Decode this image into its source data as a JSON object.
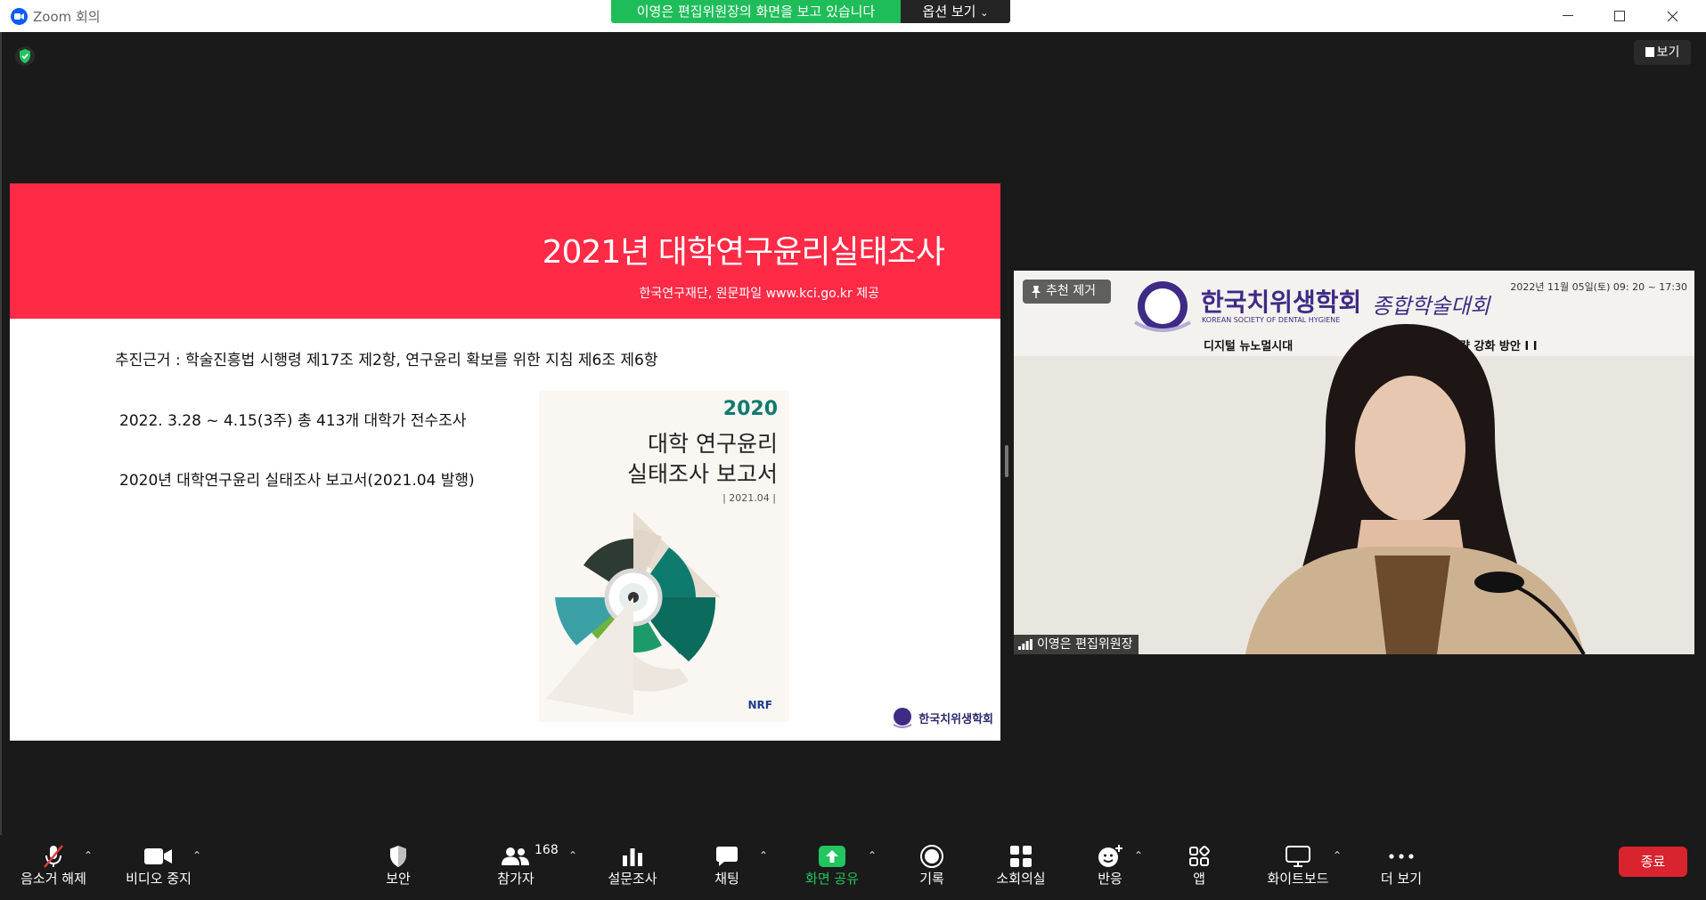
{
  "window": {
    "title": "Zoom 회의",
    "share_banner": "이영은 편집위원장의 화면을 보고 있습니다",
    "options_label": "옵션 보기",
    "view_label": "보기"
  },
  "slide": {
    "title": "2021년 대학연구윤리실태조사",
    "subtitle": "한국연구재단, 원문파일 www.kci.go.kr 제공",
    "line1": "추진근거 : 학술진흥법 시행령 제17조 제2항, 연구윤리 확보를 위한 지침 제6조 제6항",
    "line2": "2022. 3.28 ~ 4.15(3주) 총 413개 대학가 전수조사",
    "line3": "2020년 대학연구윤리 실태조사 보고서(2021.04 발행)",
    "cover": {
      "year": "2020",
      "title1": "대학 연구윤리",
      "title2": "실태조사 보고서",
      "date": "| 2021.04 |",
      "logo": "NRF"
    },
    "logo_text": "한국치위생학회"
  },
  "video": {
    "date": "2022년 11월 05일(토) 09: 20 ~ 17:30",
    "org_ko": "한국치위생학회",
    "org_en": "KOREAN SOCIETY OF DENTAL HYGIENE",
    "event": "종합학술대회",
    "sub_left": "디지털 뉴노멀시대",
    "sub_right": "략 강화 방안 I I",
    "unpin_label": "추천 제거",
    "participant_name": "이영은 편집위원장"
  },
  "toolbar": {
    "mute": "음소거 해제",
    "video": "비디오 중지",
    "security": "보안",
    "participants": "참가자",
    "participants_count": "168",
    "polls": "설문조사",
    "chat": "채팅",
    "share": "화면 공유",
    "record": "기록",
    "breakout": "소회의실",
    "reactions": "반응",
    "apps": "앱",
    "whiteboard": "화이트보드",
    "more": "더 보기",
    "end": "종료"
  },
  "colors": {
    "slide_header": "#ff2a46",
    "share_green": "#1fbd5a",
    "end_red": "#d9232e"
  }
}
